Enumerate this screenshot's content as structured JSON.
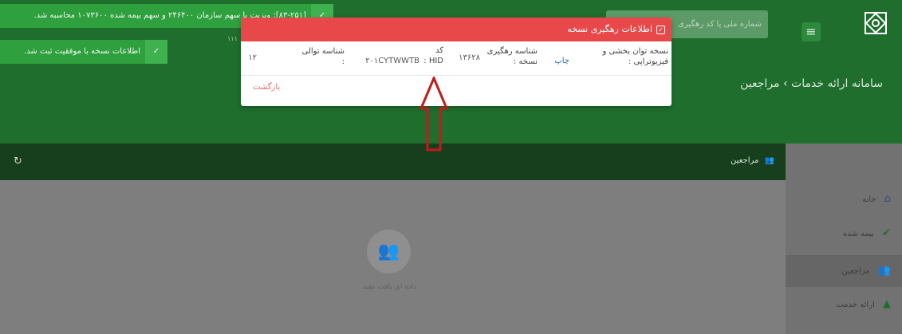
{
  "header": {
    "search_placeholder": "شماره ملی یا کد رهگیری",
    "page_title": "سامانه ارائه خدمات › مراجعین",
    "faint_text": "",
    "side_number": "۱۱۱"
  },
  "toolbar": {
    "title": "مراجعین"
  },
  "empty": {
    "message": "داده ای یافت نشد."
  },
  "sidebar": {
    "items": [
      {
        "label": "خانه"
      },
      {
        "label": "بیمه شده"
      },
      {
        "label": "مراجعین"
      },
      {
        "label": "ارائه خدمت"
      }
    ]
  },
  "toasts": [
    {
      "message": "[۸۳-۲۵۱]: ویزیت با سهم سازمان ۲۴۶۴۰۰ و سهم بیمه شده ۱۰۷۳۶۰۰ محاسبه شد."
    },
    {
      "message": "اطلاعات نسخه با موفقیت ثبت شد."
    }
  ],
  "modal": {
    "title": "اطلاعات رهگیری نسخه",
    "label_prescription": "نسخه توان بخشی و فیزیوتراپی :",
    "print_link": "چاپ",
    "label_tracking": "شناسه رهگیری نسخه :",
    "tracking_value": "۱۳۶۲۸",
    "label_hid": "کد HID :",
    "hid_value": "۲۰۱CYTWWTB",
    "label_sequence": "شناسه توالی :",
    "sequence_value": "۱۲",
    "back_label": "بازگشت"
  },
  "colors": {
    "header_green": "#1f6e2e",
    "toolbar_dark": "#173f1d",
    "toast_green": "#2ea03e",
    "modal_red": "#e8484a",
    "link_blue": "#2f6fbf",
    "annotation_red": "#c41a1a"
  }
}
